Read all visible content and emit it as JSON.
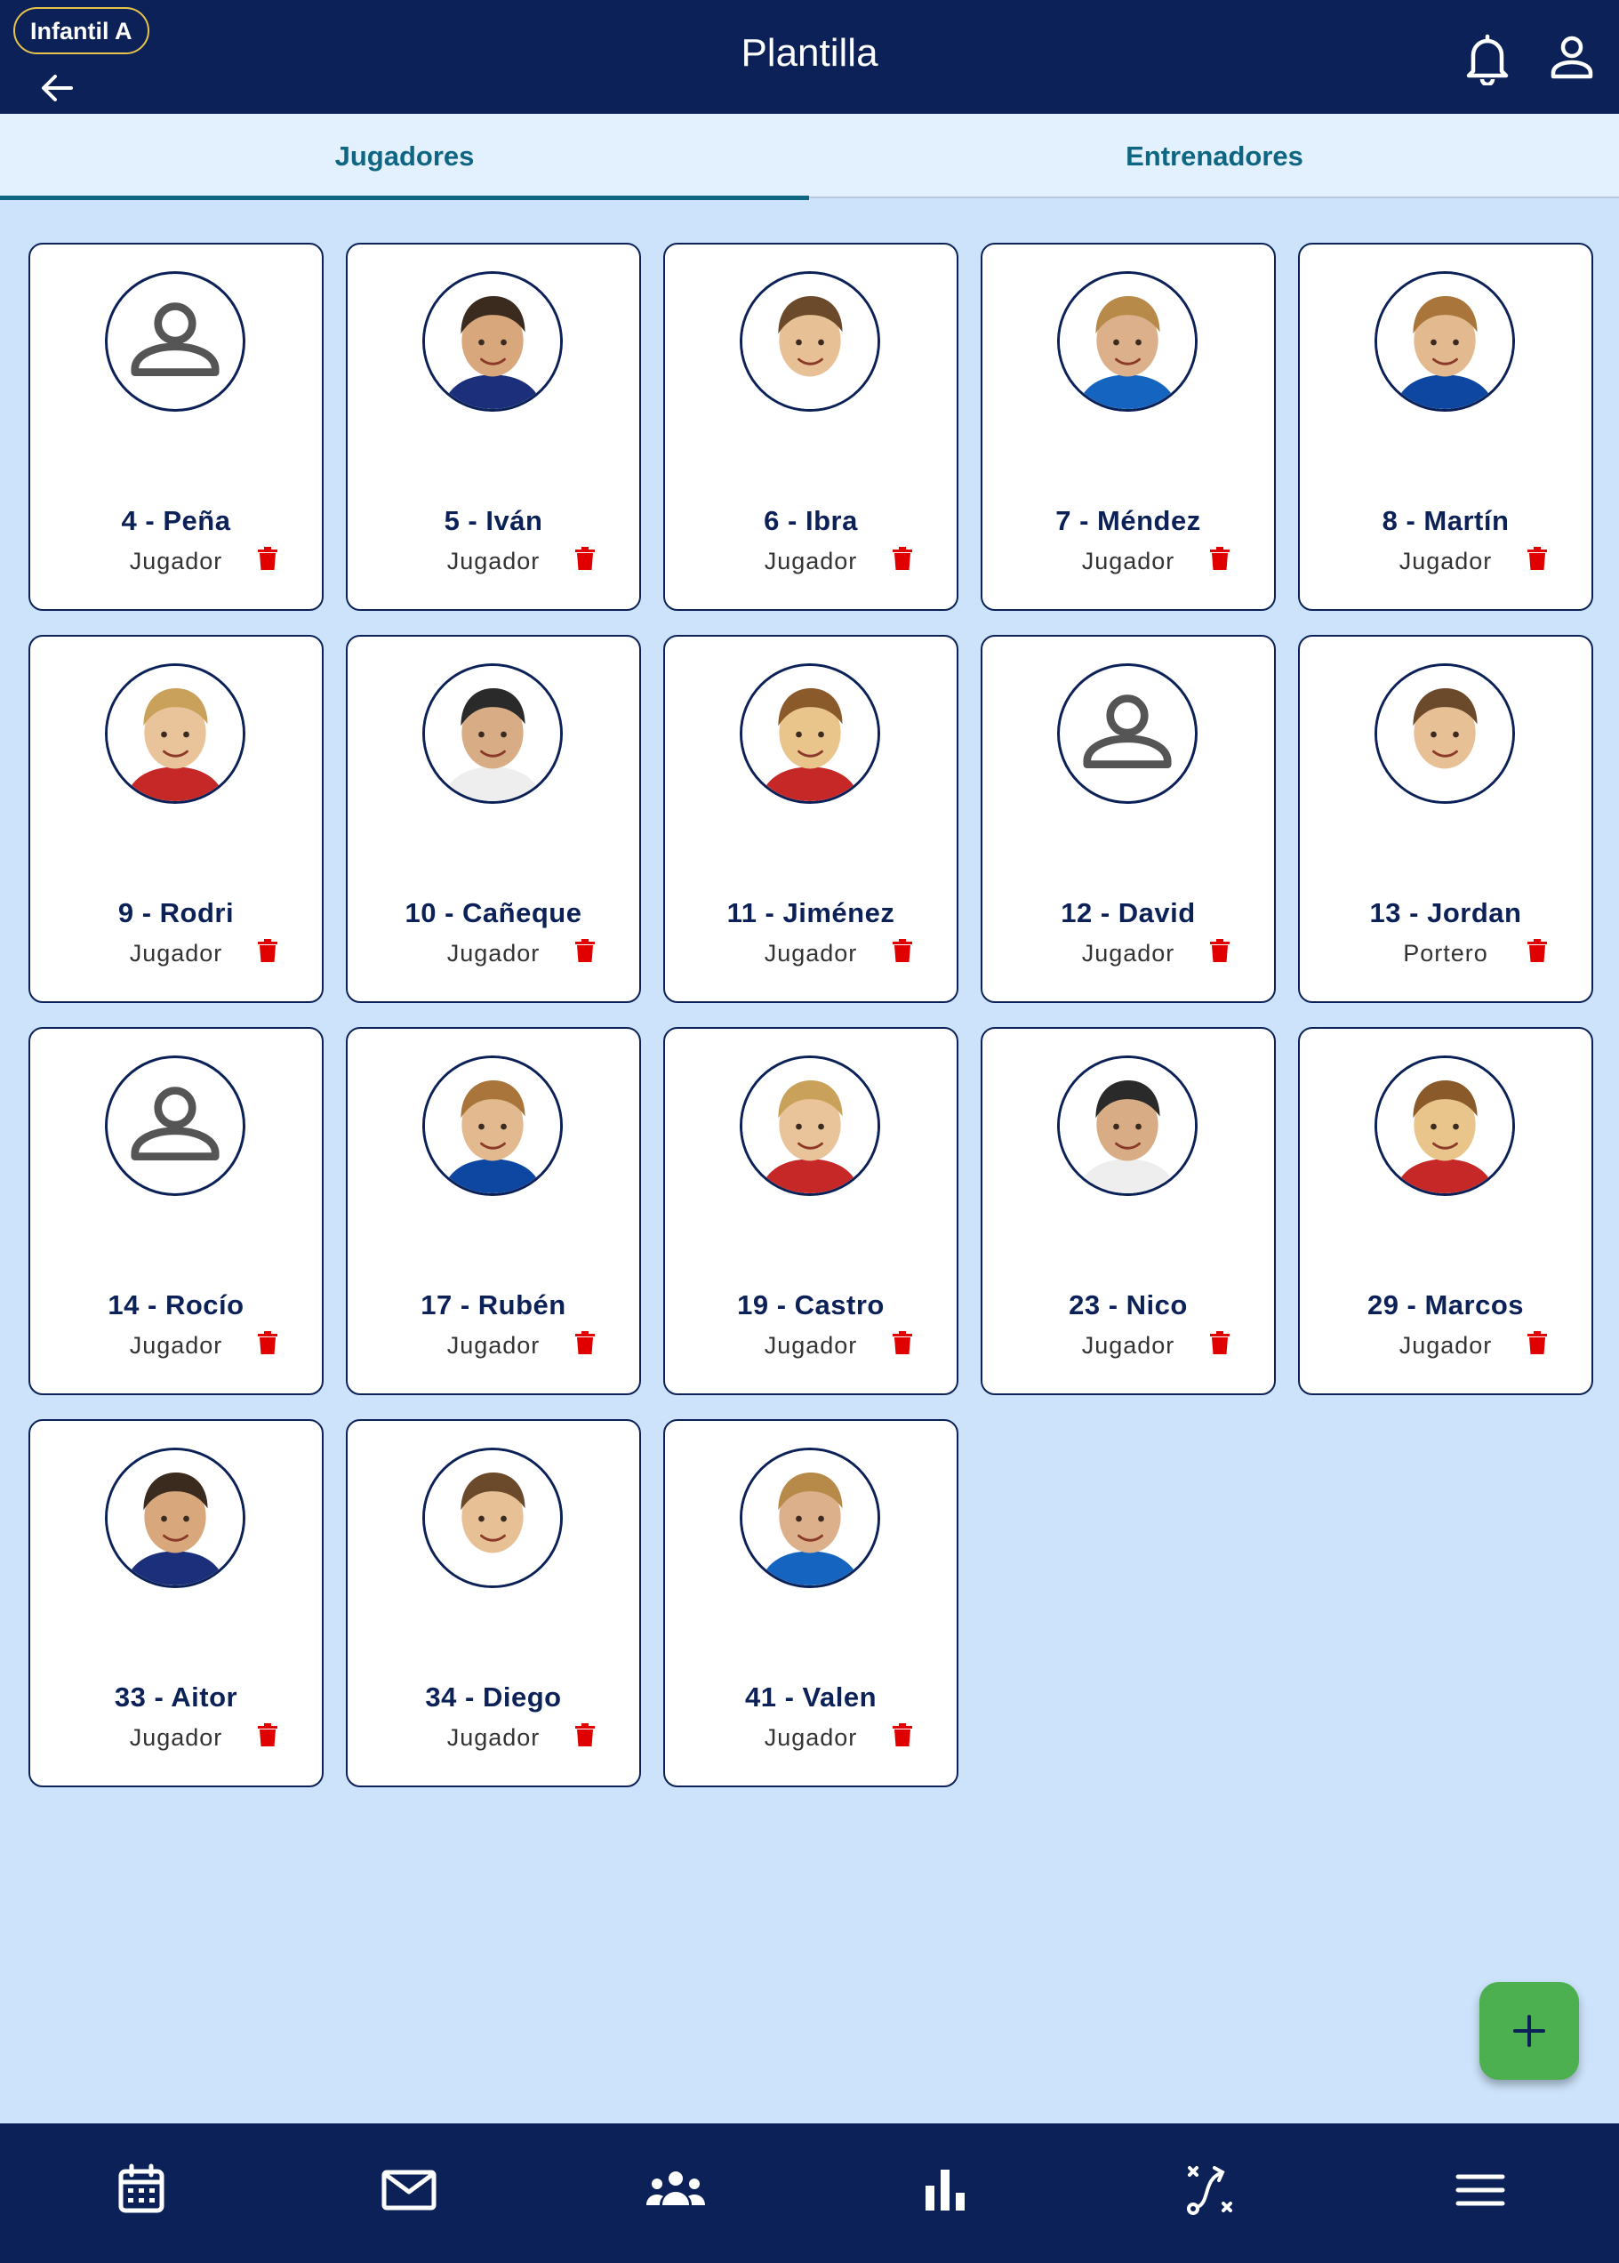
{
  "header": {
    "team_badge": "Infantil A",
    "title": "Plantilla",
    "icons": [
      "back-arrow-icon",
      "bell-icon",
      "user-icon"
    ]
  },
  "tabs": [
    {
      "label": "Jugadores",
      "active": true
    },
    {
      "label": "Entrenadores",
      "active": false
    }
  ],
  "players": [
    {
      "name": "4 - Peña",
      "role": "Jugador",
      "photo": false
    },
    {
      "name": "5 - Iván",
      "role": "Jugador",
      "photo": true
    },
    {
      "name": "6 - Ibra",
      "role": "Jugador",
      "photo": true
    },
    {
      "name": "7 - Méndez",
      "role": "Jugador",
      "photo": true
    },
    {
      "name": "8 - Martín",
      "role": "Jugador",
      "photo": true
    },
    {
      "name": "9 - Rodri",
      "role": "Jugador",
      "photo": true
    },
    {
      "name": "10 - Cañeque",
      "role": "Jugador",
      "photo": true
    },
    {
      "name": "11 - Jiménez",
      "role": "Jugador",
      "photo": true
    },
    {
      "name": "12 - David",
      "role": "Jugador",
      "photo": false
    },
    {
      "name": "13 - Jordan",
      "role": "Portero",
      "photo": true
    },
    {
      "name": "14 - Rocío",
      "role": "Jugador",
      "photo": false
    },
    {
      "name": "17 - Rubén",
      "role": "Jugador",
      "photo": true
    },
    {
      "name": "19 - Castro",
      "role": "Jugador",
      "photo": true
    },
    {
      "name": "23 - Nico",
      "role": "Jugador",
      "photo": true
    },
    {
      "name": "29 - Marcos",
      "role": "Jugador",
      "photo": true
    },
    {
      "name": "33 - Aitor",
      "role": "Jugador",
      "photo": true
    },
    {
      "name": "34 - Diego",
      "role": "Jugador",
      "photo": true
    },
    {
      "name": "41 - Valen",
      "role": "Jugador",
      "photo": true
    }
  ],
  "fab": {
    "icon": "plus-icon"
  },
  "bottom_nav": [
    "calendar-icon",
    "mail-icon",
    "team-icon",
    "stats-icon",
    "tactics-icon",
    "menu-icon"
  ],
  "colors": {
    "header_bg": "#0b2157",
    "page_bg": "#cde3fb",
    "tab_text": "#0f6683",
    "delete": "#e00000",
    "fab": "#4caf50",
    "badge_border": "#e8c44a"
  }
}
